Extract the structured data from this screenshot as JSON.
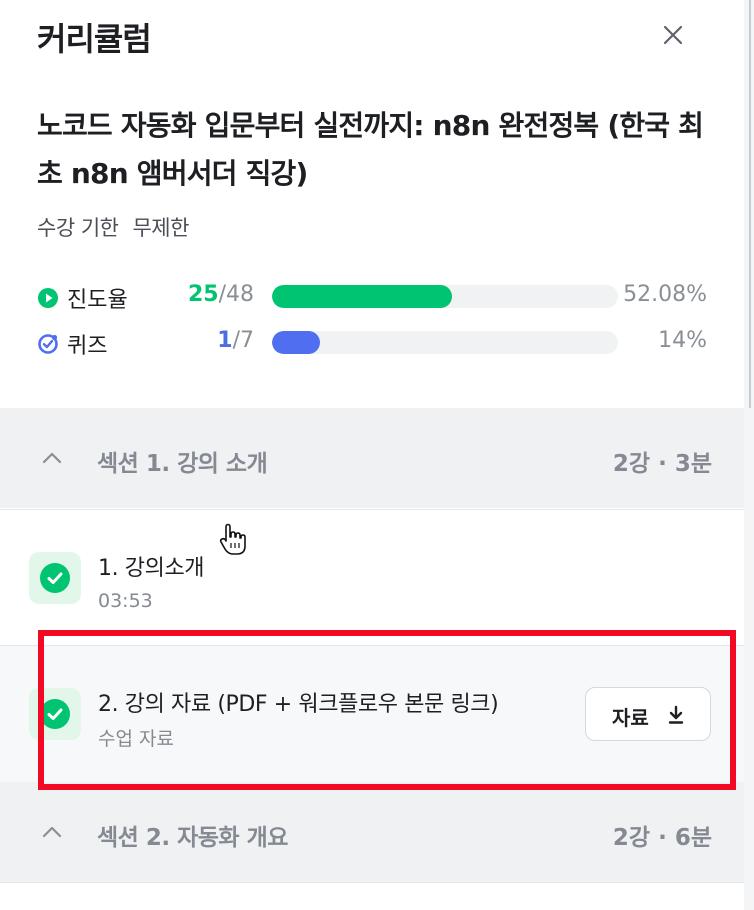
{
  "panel": {
    "title": "커리큘럼",
    "close_icon": "close-icon"
  },
  "course": {
    "title": "노코드 자동화 입문부터 실전까지: n8n 완전정복 (한국 최초 n8n 앰버서더 직강)",
    "period_label": "수강 기한",
    "period_value": "무제한"
  },
  "stats": {
    "progress": {
      "label": "진도율",
      "done": "25",
      "total": "/48",
      "percent": "52.08%",
      "fraction": 0.5208,
      "color": "#00c471",
      "icon": "play-circle-icon"
    },
    "quiz": {
      "label": "퀴즈",
      "done": "1",
      "total": "/7",
      "percent": "14%",
      "fraction": 0.14,
      "color": "#4f6ff0",
      "icon": "quiz-check-icon"
    }
  },
  "sections": [
    {
      "title": "섹션 1. 강의 소개",
      "meta": "2강 · 3분",
      "expanded": true,
      "lessons": [
        {
          "title": "1. 강의소개",
          "sub": "03:53",
          "completed": true
        },
        {
          "title": "2. 강의 자료 (PDF + 워크플로우 본문 링크)",
          "sub": "수업 자료",
          "completed": true,
          "button_label": "자료"
        }
      ]
    },
    {
      "title": "섹션 2. 자동화 개요",
      "meta": "2강 · 6분",
      "expanded": true
    }
  ]
}
